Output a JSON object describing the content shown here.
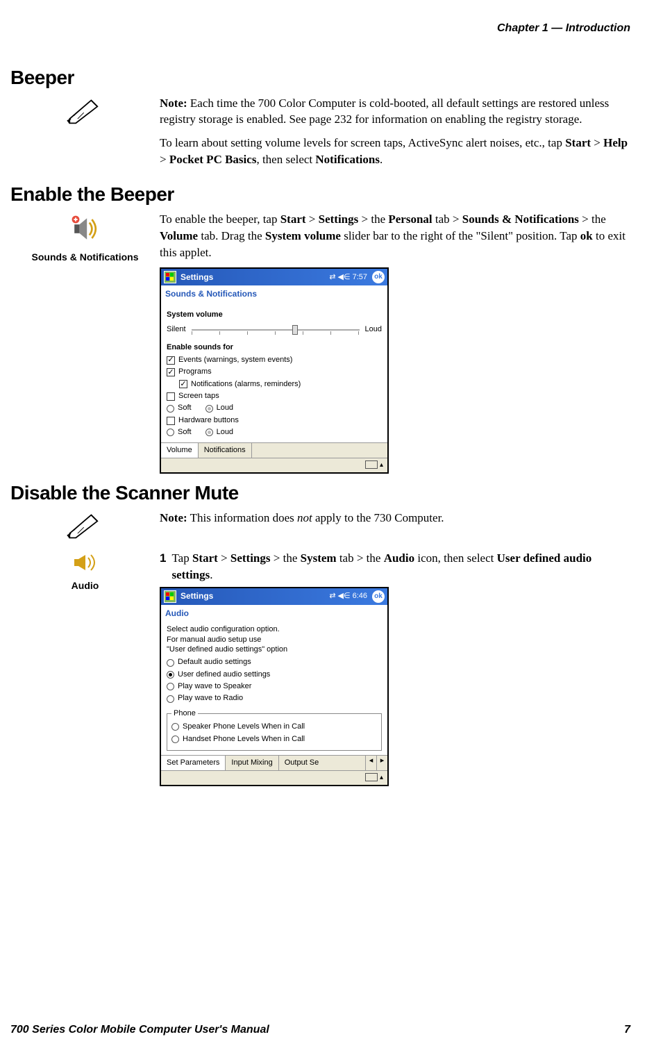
{
  "header": {
    "chapter": "Chapter 1 — Introduction"
  },
  "beeper": {
    "heading": "Beeper",
    "note_bold": "Note:",
    "note_text": " Each time the 700 Color Computer is cold-booted, all default settings are restored unless registry storage is enabled. See page 232 for information on enabling the registry storage.",
    "para2_pre": "To learn about setting volume levels for screen taps, ActiveSync alert noises, etc., tap ",
    "start": "Start",
    "gt1": " > ",
    "help": "Help",
    "gt2": " > ",
    "pocket": "Pocket PC Basics",
    "para2_mid": ", then select ",
    "notif": "Notifications",
    "period": "."
  },
  "enable": {
    "heading": "Enable the Beeper",
    "icon_label": "Sounds & Notifications",
    "p_pre": "To enable the beeper, tap ",
    "start": "Start",
    "gt1": " > ",
    "settings": "Settings",
    "gt2": " > the ",
    "personal": "Personal",
    "gt3": " tab > ",
    "sounds": "Sounds & Notifications",
    "gt4": " > the ",
    "volume": "Volume",
    "p_mid": " tab. Drag the ",
    "sysvol": "System volume",
    "p_mid2": " slider bar to the right of the \"Silent\" position. Tap ",
    "ok": "ok",
    "p_end": " to exit this applet."
  },
  "ss1": {
    "title": "Settings",
    "time": "7:57",
    "ok": "ok",
    "subtitle": "Sounds & Notifications",
    "sysvol": "System volume",
    "silent": "Silent",
    "loud": "Loud",
    "enable": "Enable sounds for",
    "events": "Events (warnings, system events)",
    "programs": "Programs",
    "notifs": "Notifications (alarms, reminders)",
    "taps": "Screen taps",
    "soft": "Soft",
    "loud2": "Loud",
    "hwbtn": "Hardware buttons",
    "tab1": "Volume",
    "tab2": "Notifications"
  },
  "disable": {
    "heading": "Disable the Scanner Mute",
    "note_bold": "Note:",
    "note_pre": " This information does ",
    "not": "not",
    "note_post": " apply to the 730 Computer.",
    "audio_label": "Audio",
    "step1_num": "1",
    "s1_pre": "Tap ",
    "start": "Start",
    "gt1": " > ",
    "settings": "Settings",
    "gt2": " > the ",
    "system": "System",
    "gt3": " tab > the ",
    "audio": "Audio",
    "s1_mid": " icon, then select ",
    "user": "User defined audio settings",
    "period": "."
  },
  "ss2": {
    "title": "Settings",
    "time": "6:46",
    "ok": "ok",
    "subtitle": "Audio",
    "intro1": "Select audio configuration option.",
    "intro2": "For manual audio setup use",
    "intro3": "\"User defined audio settings\" option",
    "opt1": "Default audio settings",
    "opt2": "User defined audio settings",
    "opt3": "Play wave to Speaker",
    "opt4": "Play wave to Radio",
    "phone_legend": "Phone",
    "phone1": "Speaker Phone Levels When in Call",
    "phone2": "Handset Phone Levels When in Call",
    "tab1": "Set Parameters",
    "tab2": "Input Mixing",
    "tab3": "Output Se"
  },
  "footer": {
    "manual": "700 Series Color Mobile Computer User's Manual",
    "page": "7"
  }
}
